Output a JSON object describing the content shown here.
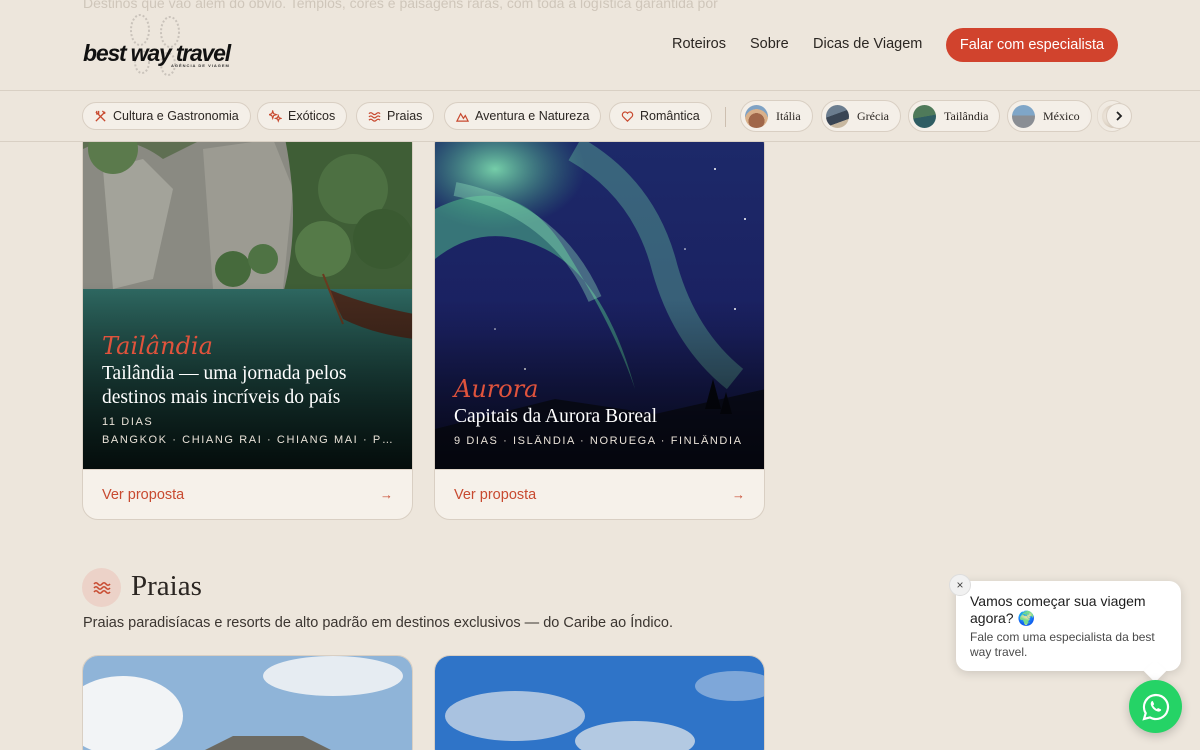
{
  "header": {
    "ghost_text": "Destinos que vão além do óbvio. Templos, cores e paisagens raras, com toda a logística garantida por",
    "logo": {
      "main": "best way travel",
      "sub": "AGÊNCIA DE VIAGEM"
    },
    "nav": [
      "Roteiros",
      "Sobre",
      "Dicas de Viagem"
    ],
    "cta": "Falar com especialista"
  },
  "filters": {
    "categories": [
      {
        "label": "Cultura e Gastronomia",
        "icon": "utensils-icon"
      },
      {
        "label": "Exóticos",
        "icon": "sparkle-icon"
      },
      {
        "label": "Praias",
        "icon": "waves-icon"
      },
      {
        "label": "Aventura e Natureza",
        "icon": "mountain-icon"
      },
      {
        "label": "Romântica",
        "icon": "heart-icon"
      }
    ],
    "destinations": [
      "Itália",
      "Grécia",
      "Tailândia",
      "México"
    ]
  },
  "cards": [
    {
      "script": "Tailândia",
      "title": "Tailândia — uma jornada pelos destinos mais incríveis do país",
      "days": "11 DIAS",
      "places": "BANGKOK · CHIANG RAI · CHIANG MAI · PHUKET…",
      "link": "Ver proposta",
      "arrow": "→"
    },
    {
      "script": "Aurora",
      "title": "Capitais da Aurora Boreal",
      "meta": "9 DIAS · ISLÂNDIA · NORUEGA · FINLÂNDIA",
      "link": "Ver proposta",
      "arrow": "→"
    }
  ],
  "section": {
    "title": "Praias",
    "description": "Praias paradisíacas e resorts de alto padrão em destinos exclusivos — do Caribe ao Índico."
  },
  "chat": {
    "close": "×",
    "title": "Vamos começar sua viagem agora? 🌍",
    "subtitle": "Fale com uma especialista da best way travel."
  },
  "colors": {
    "accent": "#d1432d",
    "background": "#ede6dc",
    "whatsapp": "#25d366"
  }
}
